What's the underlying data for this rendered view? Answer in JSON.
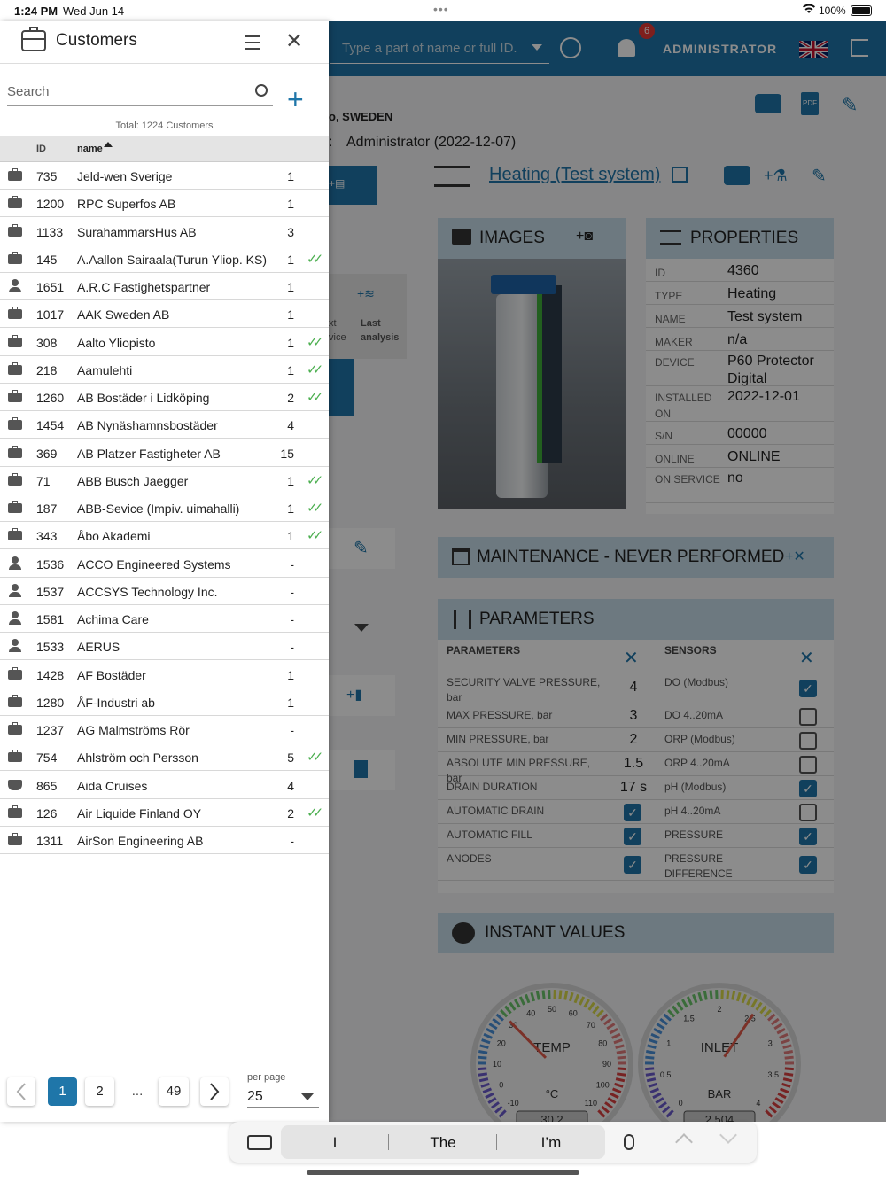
{
  "status_bar": {
    "time": "1:24 PM",
    "date": "Wed Jun 14",
    "battery": "100%"
  },
  "topbar": {
    "search_placeholder": "Type a part of name or full ID.",
    "notification_count": "6",
    "user_label": "ADMINISTRATOR"
  },
  "background": {
    "location": "o, SWEDEN",
    "created_by": "Administrator (2022-12-07)",
    "system_title": "Heating (Test system)",
    "last_analysis_a": "xt",
    "last_analysis_a2": "vice",
    "last_analysis_b": "Last",
    "last_analysis_b2": "analysis",
    "images_title": "IMAGES",
    "properties_title": "PROPERTIES",
    "properties": [
      {
        "key": "ID",
        "value": "4360"
      },
      {
        "key": "TYPE",
        "value": "Heating"
      },
      {
        "key": "NAME",
        "value": "Test system"
      },
      {
        "key": "MAKER",
        "value": "n/a"
      },
      {
        "key": "DEVICE",
        "value": "P60 Protector Digital"
      },
      {
        "key": "INSTALLED ON",
        "value": "2022-12-01"
      },
      {
        "key": "S/N",
        "value": "00000"
      },
      {
        "key": "ONLINE",
        "value": "ONLINE"
      },
      {
        "key": "ON SERVICE",
        "value": "no"
      }
    ],
    "maintenance_title": "MAINTENANCE - NEVER PERFORMED",
    "parameters_title": "PARAMETERS",
    "params_header": "PARAMETERS",
    "sensors_header": "SENSORS",
    "params": [
      {
        "name": "SECURITY VALVE PRESSURE, bar",
        "value": "4",
        "sensor": "DO (Modbus)",
        "sensor_checked": true
      },
      {
        "name": "MAX PRESSURE, bar",
        "value": "3",
        "sensor": "DO 4..20mA",
        "sensor_checked": false
      },
      {
        "name": "MIN PRESSURE, bar",
        "value": "2",
        "sensor": "ORP (Modbus)",
        "sensor_checked": false
      },
      {
        "name": "ABSOLUTE MIN PRESSURE, bar",
        "value": "1.5",
        "sensor": "ORP 4..20mA",
        "sensor_checked": false
      },
      {
        "name": "DRAIN DURATION",
        "value": "17 s",
        "sensor": "pH (Modbus)",
        "sensor_checked": true
      },
      {
        "name": "AUTOMATIC DRAIN",
        "value": "",
        "sensor": "pH 4..20mA",
        "sensor_checked": false
      },
      {
        "name": "AUTOMATIC FILL",
        "value": "",
        "sensor": "PRESSURE",
        "sensor_checked": true
      },
      {
        "name": "ANODES",
        "value": "",
        "sensor": "PRESSURE DIFFERENCE",
        "sensor_checked": true
      }
    ],
    "instant_title": "INSTANT VALUES",
    "gauge_temp": {
      "label": "TEMP",
      "unit": "°C",
      "value": "30.2",
      "ticks": [
        "-10",
        "0",
        "10",
        "20",
        "30",
        "40",
        "50",
        "60",
        "70",
        "80",
        "90",
        "100",
        "110"
      ]
    },
    "gauge_inlet": {
      "label": "INLET",
      "unit": "BAR",
      "value": "2.504",
      "ticks": [
        "0",
        "0.5",
        "1",
        "1.5",
        "2",
        "2.5",
        "3",
        "3.5",
        "4"
      ]
    }
  },
  "drawer": {
    "title": "Customers",
    "search_placeholder": "Search",
    "total": "Total: 1224 Customers",
    "col_id": "ID",
    "col_name": "name",
    "rows": [
      {
        "icon": "briefcase",
        "id": "735",
        "name": "Jeld-wen Sverige",
        "count": "1",
        "ok": false
      },
      {
        "icon": "briefcase",
        "id": "1200",
        "name": "RPC Superfos AB",
        "count": "1",
        "ok": false
      },
      {
        "icon": "briefcase",
        "id": "1133",
        "name": "SurahammarsHus AB",
        "count": "3",
        "ok": false
      },
      {
        "icon": "briefcase",
        "id": "145",
        "name": "A.Aallon Sairaala(Turun Yliop. KS)",
        "count": "1",
        "ok": true
      },
      {
        "icon": "person",
        "id": "1651",
        "name": "A.R.C Fastighetspartner",
        "count": "1",
        "ok": false
      },
      {
        "icon": "briefcase",
        "id": "1017",
        "name": "AAK Sweden AB",
        "count": "1",
        "ok": false
      },
      {
        "icon": "briefcase",
        "id": "308",
        "name": "Aalto Yliopisto",
        "count": "1",
        "ok": true
      },
      {
        "icon": "briefcase",
        "id": "218",
        "name": "Aamulehti",
        "count": "1",
        "ok": true
      },
      {
        "icon": "briefcase",
        "id": "1260",
        "name": "AB Bostäder i Lidköping",
        "count": "2",
        "ok": true
      },
      {
        "icon": "briefcase",
        "id": "1454",
        "name": "AB Nynäshamnsbostäder",
        "count": "4",
        "ok": false
      },
      {
        "icon": "briefcase",
        "id": "369",
        "name": "AB Platzer Fastigheter AB",
        "count": "15",
        "ok": false
      },
      {
        "icon": "briefcase",
        "id": "71",
        "name": "ABB Busch Jaegger",
        "count": "1",
        "ok": true
      },
      {
        "icon": "briefcase",
        "id": "187",
        "name": "ABB-Sevice (Impiv. uimahalli)",
        "count": "1",
        "ok": true
      },
      {
        "icon": "briefcase",
        "id": "343",
        "name": "Åbo Akademi",
        "count": "1",
        "ok": true
      },
      {
        "icon": "person",
        "id": "1536",
        "name": "ACCO Engineered Systems",
        "count": "-",
        "ok": false
      },
      {
        "icon": "person",
        "id": "1537",
        "name": "ACCSYS Technology Inc.",
        "count": "-",
        "ok": false
      },
      {
        "icon": "person",
        "id": "1581",
        "name": "Achima Care",
        "count": "-",
        "ok": false
      },
      {
        "icon": "person",
        "id": "1533",
        "name": "AERUS",
        "count": "-",
        "ok": false
      },
      {
        "icon": "briefcase",
        "id": "1428",
        "name": "AF Bostäder",
        "count": "1",
        "ok": false
      },
      {
        "icon": "briefcase",
        "id": "1280",
        "name": "ÅF-Industri ab",
        "count": "1",
        "ok": false
      },
      {
        "icon": "briefcase",
        "id": "1237",
        "name": "AG Malmströms Rör",
        "count": "-",
        "ok": false
      },
      {
        "icon": "briefcase",
        "id": "754",
        "name": "Ahlström och Persson",
        "count": "5",
        "ok": true
      },
      {
        "icon": "ship",
        "id": "865",
        "name": "Aida Cruises",
        "count": "4",
        "ok": false
      },
      {
        "icon": "briefcase",
        "id": "126",
        "name": "Air Liquide Finland OY",
        "count": "2",
        "ok": true
      },
      {
        "icon": "briefcase",
        "id": "1311",
        "name": "AirSon Engineering AB",
        "count": "-",
        "ok": false
      }
    ],
    "pagination": {
      "current": "1",
      "next": "2",
      "ellipsis": "...",
      "last": "49",
      "per_page_label": "per page",
      "per_page_value": "25"
    }
  },
  "keyboard_bar": {
    "suggestions": [
      "I",
      "The",
      "I’m"
    ]
  },
  "colors": {
    "brand": "#1f76a9",
    "accent": "#1f76a9",
    "check": "#4caf50"
  }
}
